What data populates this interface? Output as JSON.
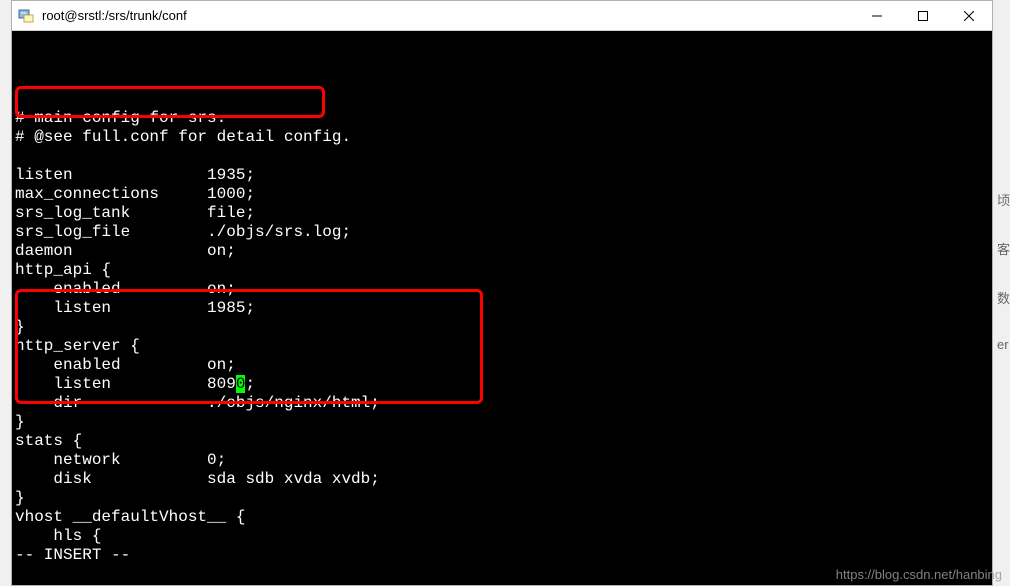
{
  "window": {
    "title": "root@srstl:/srs/trunk/conf"
  },
  "terminal": {
    "lines": [
      "# main config for srs.",
      "# @see full.conf for detail config.",
      "",
      "listen              1935;",
      "max_connections     1000;",
      "srs_log_tank        file;",
      "srs_log_file        ./objs/srs.log;",
      "daemon              on;",
      "http_api {",
      "    enabled         on;",
      "    listen          1985;",
      "}",
      "http_server {",
      "    enabled         on;",
      "    listen          809",
      "    dir             ./objs/nginx/html;",
      "}",
      "stats {",
      "    network         0;",
      "    disk            sda sdb xvda xvdb;",
      "}",
      "vhost __defaultVhost__ {",
      "    hls {",
      "-- INSERT --"
    ],
    "cursor_char": "0",
    "cursor_after": ";",
    "cursor_line": 14
  },
  "watermark": "https://blog.csdn.net/hanbing",
  "highlight1_desc": "listen-1935",
  "highlight2_desc": "http-server-block",
  "side": {
    "t1": "顷",
    "t2": "客",
    "t3": "数",
    "t4": "er"
  }
}
